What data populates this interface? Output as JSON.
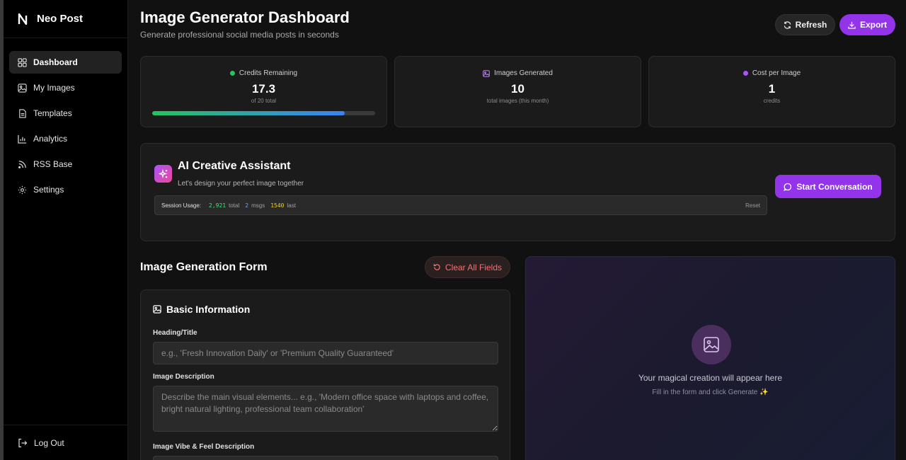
{
  "app": {
    "name": "Neo Post"
  },
  "sidebar": {
    "items": [
      {
        "label": "Dashboard",
        "icon": "dashboard-icon",
        "active": true
      },
      {
        "label": "My Images",
        "icon": "image-icon"
      },
      {
        "label": "Templates",
        "icon": "file-icon"
      },
      {
        "label": "Analytics",
        "icon": "bar-chart-icon"
      },
      {
        "label": "RSS Base",
        "icon": "rss-icon"
      },
      {
        "label": "Settings",
        "icon": "gear-icon"
      }
    ],
    "logout_label": "Log Out"
  },
  "header": {
    "title": "Image Generator Dashboard",
    "subtitle": "Generate professional social media posts in seconds",
    "refresh_label": "Refresh",
    "export_label": "Export"
  },
  "stats": {
    "credits": {
      "label": "Credits Remaining",
      "value": "17.3",
      "sub": "of 20 total",
      "progress_fraction": 0.865,
      "dot_color": "#22c55e"
    },
    "images": {
      "label": "Images Generated",
      "value": "10",
      "sub": "total images (this month)"
    },
    "cost": {
      "label": "Cost per Image",
      "value": "1",
      "sub": "credits",
      "dot_color": "#a855f7"
    }
  },
  "assistant": {
    "title": "AI Creative Assistant",
    "subtitle": "Let's design your perfect image together",
    "session_label": "Session Usage:",
    "total_value": "2,921",
    "total_word": "total",
    "msgs_value": "2",
    "msgs_word": "msgs",
    "last_value": "1540",
    "last_word": "last",
    "reset_label": "Reset",
    "start_label": "Start Conversation"
  },
  "form": {
    "title": "Image Generation Form",
    "clear_label": "Clear All Fields",
    "section_title": "Basic Information",
    "heading_label": "Heading/Title",
    "heading_placeholder": "e.g., 'Fresh Innovation Daily' or 'Premium Quality Guaranteed'",
    "description_label": "Image Description",
    "description_placeholder": "Describe the main visual elements... e.g., 'Modern office space with laptops and coffee, bright natural lighting, professional team collaboration'",
    "vibe_label": "Image Vibe & Feel Description"
  },
  "preview": {
    "text": "Your magical creation will appear here",
    "subtext": "Fill in the form and click Generate ✨"
  },
  "colors": {
    "accent": "#9333ea",
    "danger": "#f87171"
  }
}
